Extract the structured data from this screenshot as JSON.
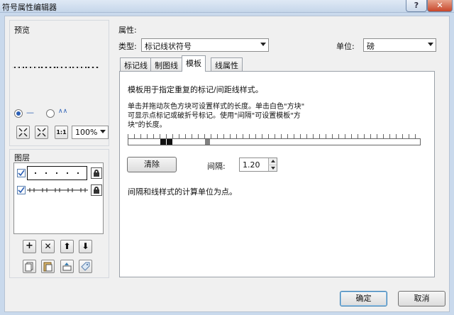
{
  "window": {
    "title": "符号属性编辑器",
    "help_label": "?",
    "close_label": "✕"
  },
  "preview": {
    "label": "预览",
    "radio_line": "—",
    "radio_wave": "∧∧",
    "zoom": "100%"
  },
  "layers": {
    "label": "图层",
    "items": [
      {
        "checked": true,
        "selected": true,
        "pattern": "dots"
      },
      {
        "checked": true,
        "selected": false,
        "pattern": "hash"
      }
    ]
  },
  "properties": {
    "label": "属性:",
    "type_label": "类型:",
    "type_value": "标记线状符号",
    "unit_label": "单位:",
    "unit_value": "磅"
  },
  "tabs": [
    {
      "label": "标记线",
      "active": false
    },
    {
      "label": "制图线",
      "active": false
    },
    {
      "label": "模板",
      "active": true
    },
    {
      "label": "线属性",
      "active": false
    }
  ],
  "template": {
    "desc1": "模板用于指定重复的标记/间距线样式。",
    "desc2_l1": "单击并拖动灰色方块可设置样式的长度。单击白色\"方块\"",
    "desc2_l2": "可显示点标记或破折号标记。使用\"间隔\"可设置模板\"方",
    "desc2_l3": "块\"的长度。",
    "clear_label": "清除",
    "interval_label": "间隔:",
    "interval_value": "1.20",
    "note": "间隔和线样式的计算单位为点。"
  },
  "footer": {
    "ok_label": "确定",
    "cancel_label": "取消"
  },
  "colors": {
    "accent": "#3c7fb1",
    "title_bg": "#c6d6ea",
    "close": "#c8462a"
  }
}
